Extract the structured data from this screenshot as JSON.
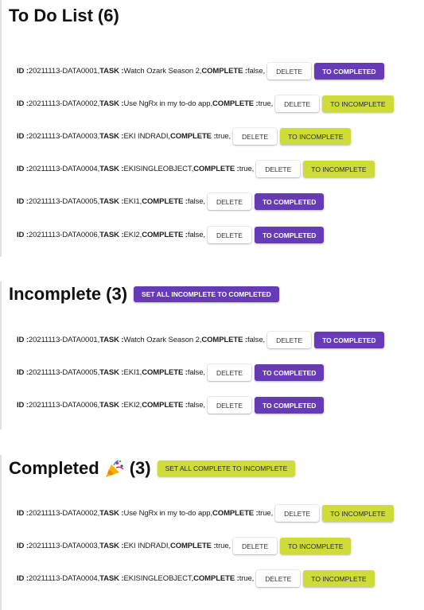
{
  "todo": {
    "title": "To Do List",
    "count": "(6)",
    "items": [
      {
        "id_label": "ID :",
        "id": "20211113-DATA0001,",
        "task_label": "TASK :",
        "task": "Watch Ozark Season 2,",
        "complete_label": "COMPLETE :",
        "complete": "false,",
        "delete_label": "DELETE",
        "toggle_label": "TO COMPLETED",
        "done": false
      },
      {
        "id_label": "ID :",
        "id": "20211113-DATA0002,",
        "task_label": "TASK :",
        "task": "Use NgRx in my to-do app,",
        "complete_label": "COMPLETE :",
        "complete": "true,",
        "delete_label": "DELETE",
        "toggle_label": "TO INCOMPLETE",
        "done": true
      },
      {
        "id_label": "ID :",
        "id": "20211113-DATA0003,",
        "task_label": "TASK :",
        "task": "EKI INDRADI,",
        "complete_label": "COMPLETE :",
        "complete": "true,",
        "delete_label": "DELETE",
        "toggle_label": "TO INCOMPLETE",
        "done": true
      },
      {
        "id_label": "ID :",
        "id": "20211113-DATA0004,",
        "task_label": "TASK :",
        "task": "EKISINGLEOBJECT,",
        "complete_label": "COMPLETE :",
        "complete": "true,",
        "delete_label": "DELETE",
        "toggle_label": "TO INCOMPLETE",
        "done": true
      },
      {
        "id_label": "ID :",
        "id": "20211113-DATA0005,",
        "task_label": "TASK :",
        "task": "EKI1,",
        "complete_label": "COMPLETE :",
        "complete": "false,",
        "delete_label": "DELETE",
        "toggle_label": "TO COMPLETED",
        "done": false
      },
      {
        "id_label": "ID :",
        "id": "20211113-DATA0006,",
        "task_label": "TASK :",
        "task": "EKI2,",
        "complete_label": "COMPLETE :",
        "complete": "false,",
        "delete_label": "DELETE",
        "toggle_label": "TO COMPLETED",
        "done": false
      }
    ]
  },
  "incomplete": {
    "title": "Incomplete",
    "count": "(3)",
    "bulk_button": "SET ALL INCOMPLETE TO COMPLETED",
    "items": [
      {
        "id_label": "ID :",
        "id": "20211113-DATA0001,",
        "task_label": "TASK :",
        "task": "Watch Ozark Season 2,",
        "complete_label": "COMPLETE :",
        "complete": "false,",
        "delete_label": "DELETE",
        "toggle_label": "TO COMPLETED",
        "done": false
      },
      {
        "id_label": "ID :",
        "id": "20211113-DATA0005,",
        "task_label": "TASK :",
        "task": "EKI1,",
        "complete_label": "COMPLETE :",
        "complete": "false,",
        "delete_label": "DELETE",
        "toggle_label": "TO COMPLETED",
        "done": false
      },
      {
        "id_label": "ID :",
        "id": "20211113-DATA0006,",
        "task_label": "TASK :",
        "task": "EKI2,",
        "complete_label": "COMPLETE :",
        "complete": "false,",
        "delete_label": "DELETE",
        "toggle_label": "TO COMPLETED",
        "done": false
      }
    ]
  },
  "completed": {
    "title": "Completed",
    "icon": "party-popper-icon",
    "count": "(3)",
    "bulk_button": "SET ALL COMPLETE TO INCOMPLETE",
    "items": [
      {
        "id_label": "ID :",
        "id": "20211113-DATA0002,",
        "task_label": "TASK :",
        "task": "Use NgRx in my to-do app,",
        "complete_label": "COMPLETE :",
        "complete": "true,",
        "delete_label": "DELETE",
        "toggle_label": "TO INCOMPLETE",
        "done": true
      },
      {
        "id_label": "ID :",
        "id": "20211113-DATA0003,",
        "task_label": "TASK :",
        "task": "EKI INDRADI,",
        "complete_label": "COMPLETE :",
        "complete": "true,",
        "delete_label": "DELETE",
        "toggle_label": "TO INCOMPLETE",
        "done": true
      },
      {
        "id_label": "ID :",
        "id": "20211113-DATA0004,",
        "task_label": "TASK :",
        "task": "EKISINGLEOBJECT,",
        "complete_label": "COMPLETE :",
        "complete": "true,",
        "delete_label": "DELETE",
        "toggle_label": "TO INCOMPLETE",
        "done": true
      }
    ]
  },
  "colors": {
    "primary": "#673ab7",
    "accent": "#cddc39"
  }
}
